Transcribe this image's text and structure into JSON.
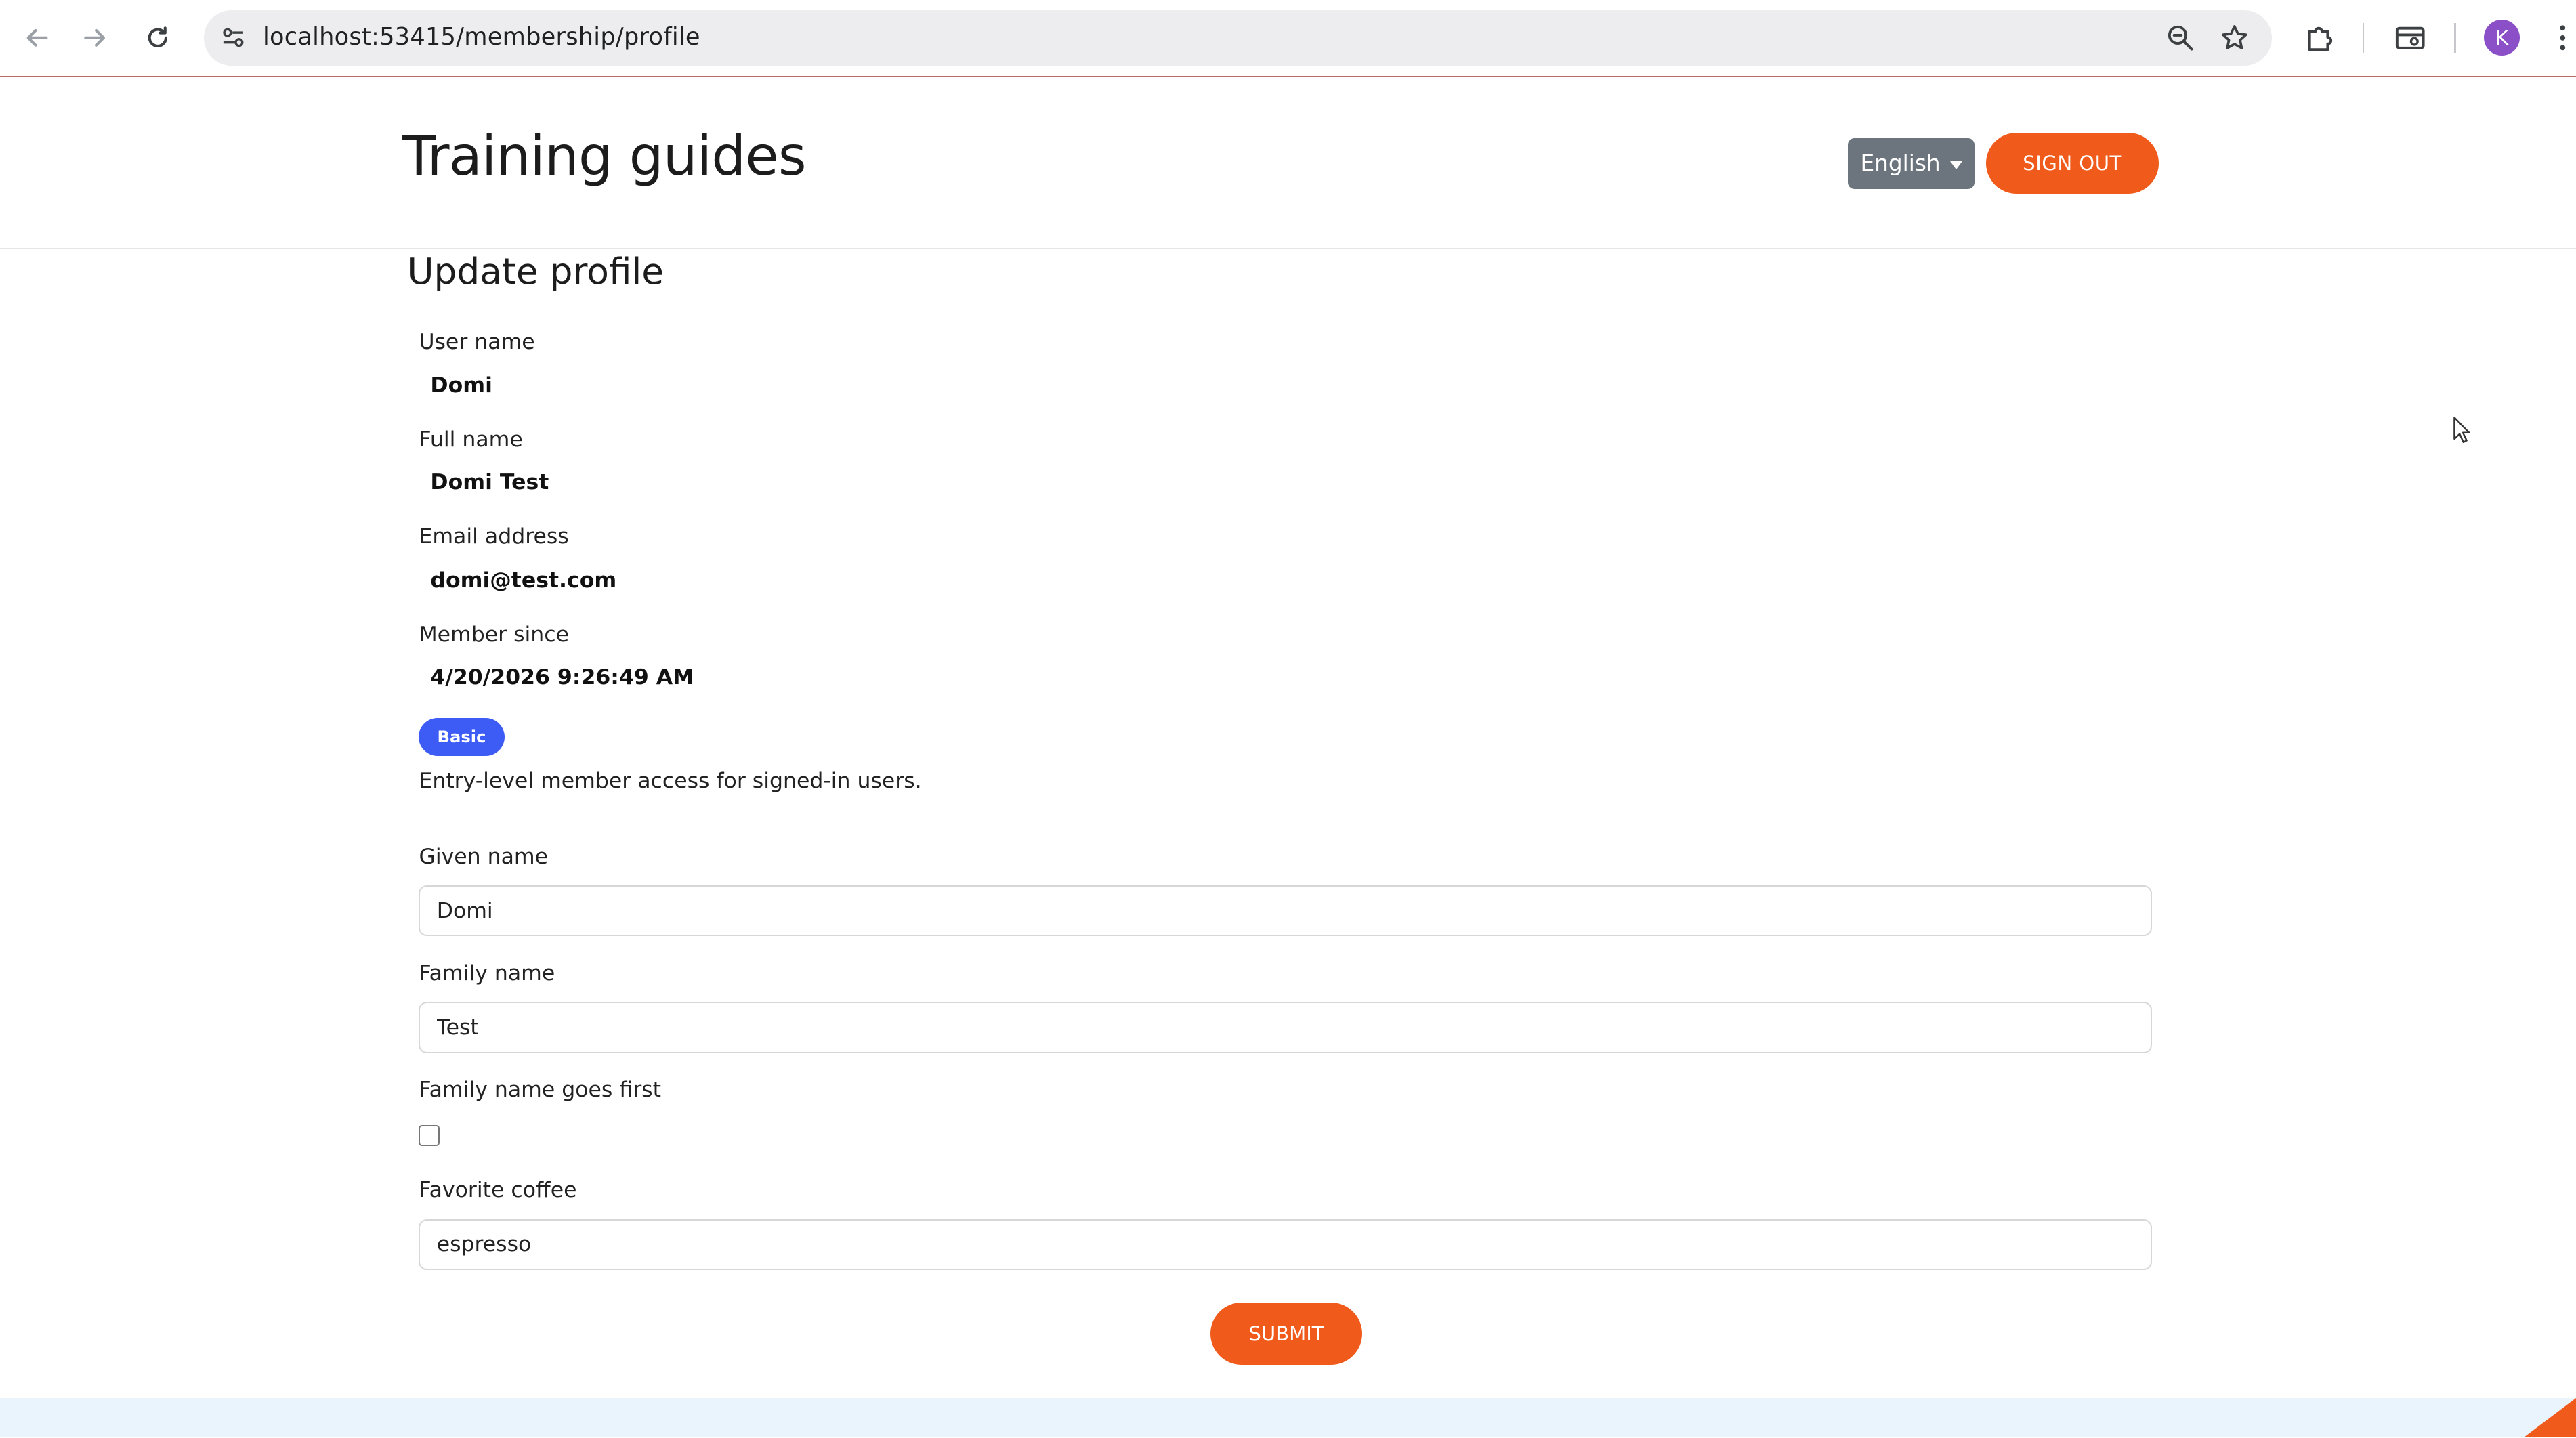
{
  "browser": {
    "url": "localhost:53415/membership/profile",
    "profile_initial": "K",
    "avatar_color": "#8b4fc7"
  },
  "header": {
    "title": "Training guides",
    "language": "English",
    "sign_out": "SIGN OUT"
  },
  "profile": {
    "heading": "Update profile",
    "user_name_label": "User name",
    "user_name": "Domi",
    "full_name_label": "Full name",
    "full_name": "Domi Test",
    "email_label": "Email address",
    "email": "domi@test.com",
    "member_since_label": "Member since",
    "member_since": "4/20/2026 9:26:49 AM",
    "tier_badge": "Basic",
    "tier_description": "Entry-level member access for signed-in users."
  },
  "form": {
    "given_name_label": "Given name",
    "given_name_value": "Domi",
    "family_name_label": "Family name",
    "family_name_value": "Test",
    "family_first_label": "Family name goes first",
    "family_first_checked": false,
    "coffee_label": "Favorite coffee",
    "coffee_value": "espresso",
    "submit": "SUBMIT"
  },
  "colors": {
    "accent": "#f05a1a",
    "badge": "#3d5cf5",
    "language_button": "#6c757d"
  }
}
